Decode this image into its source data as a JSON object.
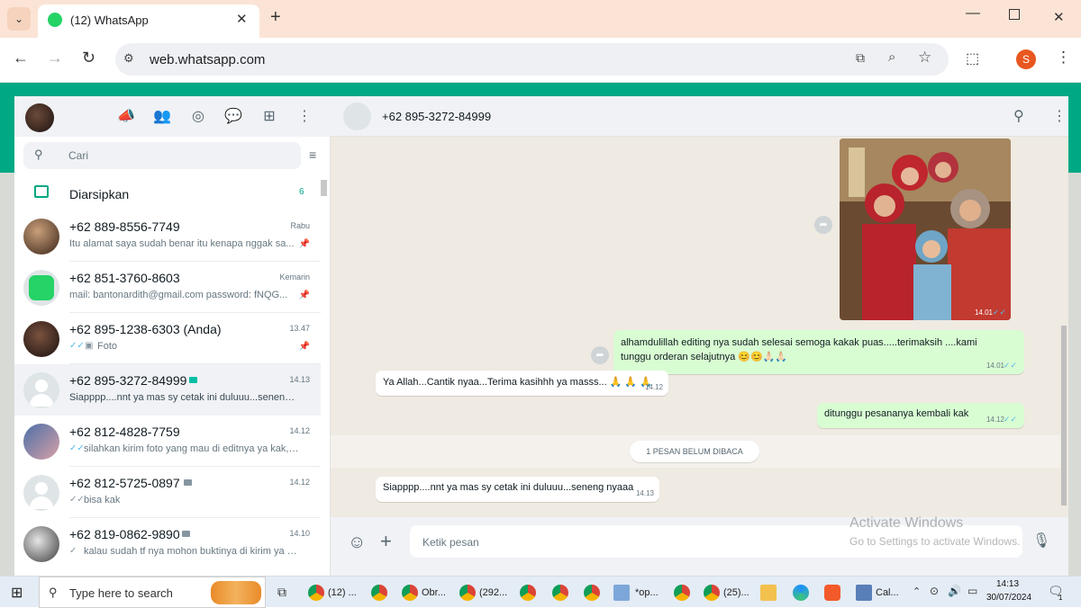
{
  "browser": {
    "tab_title": "(12) WhatsApp",
    "url": "web.whatsapp.com",
    "profile_initial": "S"
  },
  "left": {
    "search_placeholder": "Cari",
    "archived_label": "Diarsipkan",
    "archived_count": "6",
    "chats": [
      {
        "name": "+62 889-8556-7749",
        "preview": "Itu alamat saya sudah benar itu kenapa nggak sa...",
        "time": "Rabu",
        "pinned": true
      },
      {
        "name": "+62 851-3760-8603",
        "preview": "mail: bantonardith@gmail.com  password: fNQG...",
        "time": "Kemarin",
        "pinned": true
      },
      {
        "name": "+62 895-1238-6303 (Anda)",
        "preview": "Foto",
        "time": "13.47",
        "pinned": true
      },
      {
        "name": "+62 895-3272-84999",
        "preview": "Siapppp....nnt ya mas sy cetak ini duluuu...seneng n...",
        "time": "14.13",
        "selected": true
      },
      {
        "name": "+62 812-4828-7759",
        "preview": "silahkan kirim foto yang mau di editnya ya kak,c...",
        "time": "14.12"
      },
      {
        "name": "+62 812-5725-0897",
        "preview": "bisa kak",
        "time": "14.12"
      },
      {
        "name": "+62 819-0862-9890",
        "preview": "kalau sudah tf nya mohon buktinya di kirim ya kak",
        "time": "14.10"
      }
    ]
  },
  "conversation": {
    "contact": "+62 895-3272-84999",
    "image_time": "14.01",
    "messages": [
      {
        "text": "alhamdulillah editing nya sudah selesai semoga kakak puas.....terimaksih ....kami tunggu orderan selajutnya 😊😊🙏🏻🙏🏻",
        "time": "14.01"
      },
      {
        "text": "Ya Allah...Cantik nyaa...Terima kasihhh ya masss... 🙏 🙏 🙏",
        "time": "14.12"
      },
      {
        "text": "ditunggu pesananya kembali kak",
        "time": "14.12"
      },
      {
        "text": "Siapppp....nnt ya mas sy cetak ini duluuu...seneng nyaaa",
        "time": "14.13"
      }
    ],
    "unread_divider": "1 PESAN BELUM DIBACA",
    "input_placeholder": "Ketik pesan"
  },
  "watermark": {
    "title": "Activate Windows",
    "subtitle": "Go to Settings to activate Windows."
  },
  "taskbar": {
    "search_placeholder": "Type here to search",
    "items": [
      "(12) ...",
      "Obr...",
      "(292...",
      "*op...",
      "(25)...",
      "Cal..."
    ],
    "time": "14:13",
    "date": "30/07/2024",
    "notification_count": "1"
  }
}
